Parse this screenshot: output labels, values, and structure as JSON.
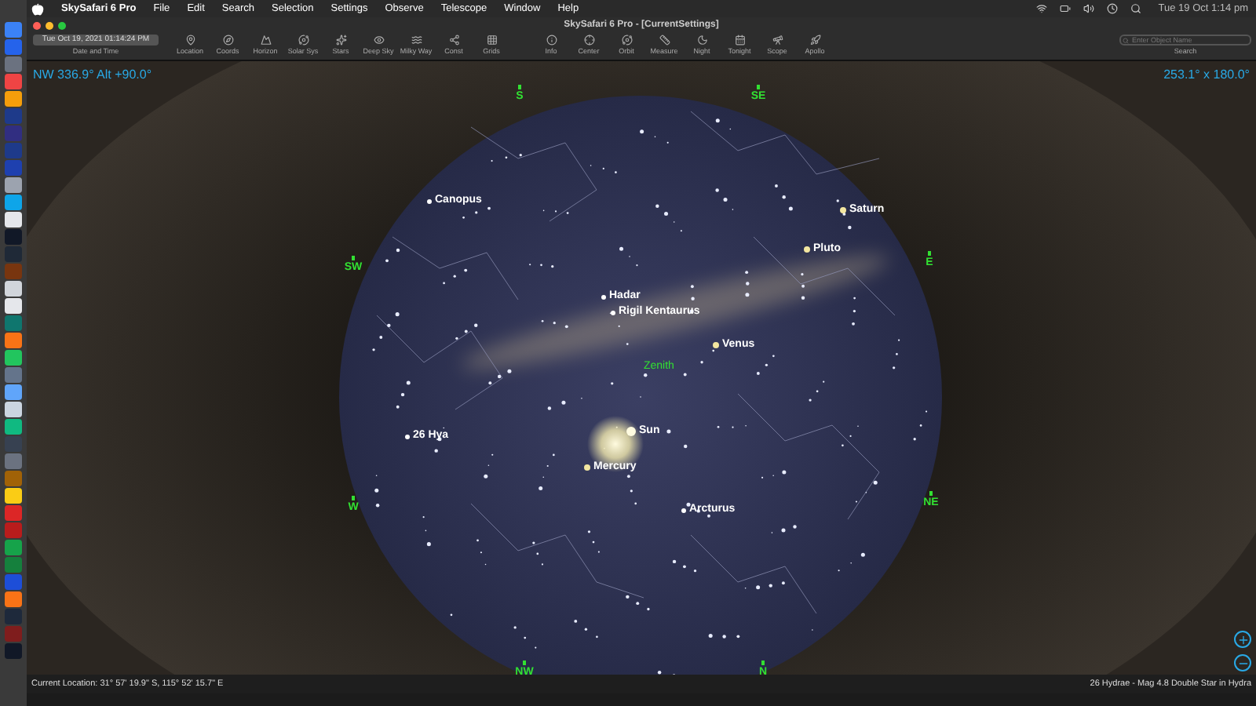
{
  "menu_bar": {
    "app": "SkySafari 6 Pro",
    "menus": [
      "File",
      "Edit",
      "Search",
      "Selection",
      "Settings",
      "Observe",
      "Telescope",
      "Window",
      "Help"
    ],
    "clock": "Tue 19 Oct  1:14 pm"
  },
  "window": {
    "title": "SkySafari 6 Pro - [CurrentSettings]"
  },
  "toolbar": {
    "date_field": {
      "value": "Tue Oct 19, 2021  01:14:24 PM",
      "label": "Date and Time"
    },
    "tools": [
      {
        "kind": "location",
        "label": "Location"
      },
      {
        "kind": "coords",
        "label": "Coords"
      },
      {
        "kind": "horizon",
        "label": "Horizon"
      },
      {
        "kind": "solarsys",
        "label": "Solar Sys"
      },
      {
        "kind": "stars",
        "label": "Stars"
      },
      {
        "kind": "deepsky",
        "label": "Deep Sky"
      },
      {
        "kind": "milkyway",
        "label": "Milky Way"
      },
      {
        "kind": "const",
        "label": "Const"
      },
      {
        "kind": "grids",
        "label": "Grids"
      },
      {
        "kind": "info",
        "label": "Info"
      },
      {
        "kind": "center",
        "label": "Center"
      },
      {
        "kind": "orbit",
        "label": "Orbit"
      },
      {
        "kind": "measure",
        "label": "Measure"
      },
      {
        "kind": "night",
        "label": "Night"
      },
      {
        "kind": "tonight",
        "label": "Tonight"
      },
      {
        "kind": "scope",
        "label": "Scope"
      },
      {
        "kind": "apollo",
        "label": "Apollo"
      }
    ],
    "search": {
      "placeholder": "Enter Object Name",
      "label": "Search"
    }
  },
  "sky": {
    "view_direction": "NW 336.9° Alt +90.0°",
    "field_of_view": "253.1° x 180.0°",
    "labels": [
      {
        "kind": "compass",
        "label": "S"
      },
      {
        "kind": "compass",
        "label": "SE"
      },
      {
        "kind": "star",
        "label": "Canopus"
      },
      {
        "kind": "planet",
        "label": "Saturn"
      },
      {
        "kind": "planet",
        "label": "Pluto"
      },
      {
        "kind": "compass",
        "label": "SW"
      },
      {
        "kind": "compass",
        "label": "E"
      },
      {
        "kind": "star",
        "label": "Hadar"
      },
      {
        "kind": "star",
        "label": "Rigil Kentaurus"
      },
      {
        "kind": "planet",
        "label": "Venus"
      },
      {
        "kind": "marker",
        "label": "Zenith"
      },
      {
        "kind": "star",
        "label": "26 Hya"
      },
      {
        "kind": "sun",
        "label": "Sun"
      },
      {
        "kind": "planet",
        "label": "Mercury"
      },
      {
        "kind": "compass",
        "label": "W"
      },
      {
        "kind": "star",
        "label": "Arcturus"
      },
      {
        "kind": "compass",
        "label": "NE"
      },
      {
        "kind": "compass",
        "label": "NW"
      },
      {
        "kind": "compass",
        "label": "N"
      }
    ]
  },
  "status_bar": {
    "location": "Current Location: 31° 57' 19.9\" S, 115° 52' 15.7\" E",
    "selection": "26 Hydrae - Mag 4.8 Double Star in Hydra"
  }
}
